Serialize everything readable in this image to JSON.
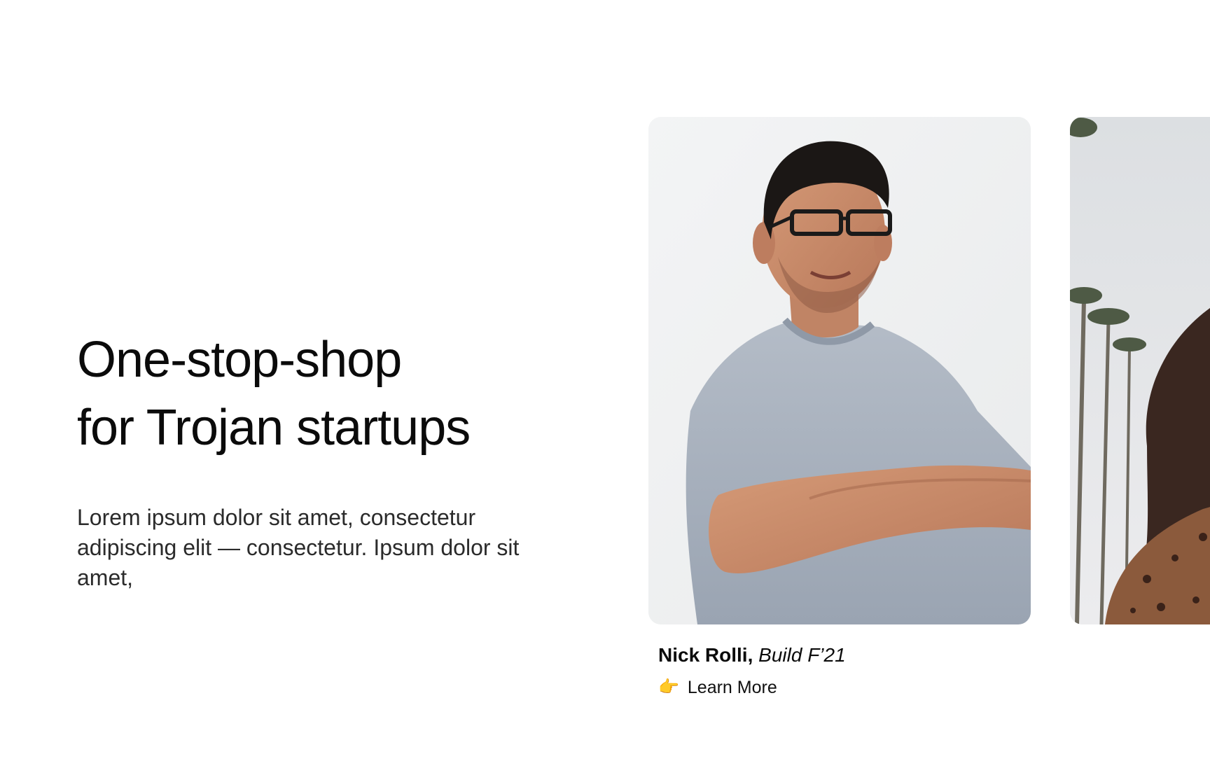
{
  "hero": {
    "title_line1": "One-stop-shop",
    "title_line2": "for Trojan startups",
    "description": "Lorem ipsum dolor sit amet, consectetur adipiscing elit — consectetur.  Ipsum dolor sit amet,"
  },
  "cards": [
    {
      "name": "Nick Rolli,",
      "cohort": "Build F’21",
      "cta_icon": "pointing-hand-icon",
      "cta_glyph": "👉",
      "cta_label": "Learn More"
    }
  ],
  "colors": {
    "background": "#ffffff",
    "text": "#0b0b0b",
    "muted_text": "#2b2b2b",
    "shirt": "#a7b0bd",
    "skin": "#c98b68"
  }
}
